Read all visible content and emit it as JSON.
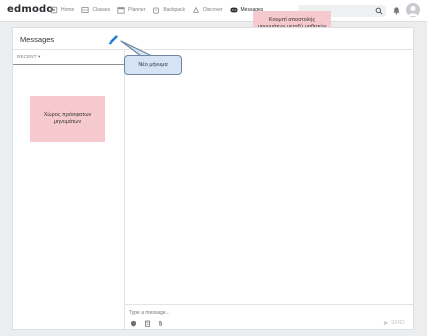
{
  "app": {
    "logo": "edmodo"
  },
  "nav": [
    {
      "label": "Home",
      "icon": "home-icon"
    },
    {
      "label": "Classes",
      "icon": "classes-icon"
    },
    {
      "label": "Planner",
      "icon": "planner-icon"
    },
    {
      "label": "Backpack",
      "icon": "backpack-icon"
    },
    {
      "label": "Discover",
      "icon": "discover-icon"
    },
    {
      "label": "Messages",
      "icon": "messages-icon",
      "active": true
    }
  ],
  "search": {
    "placeholder": "Search"
  },
  "messages": {
    "title": "Messages",
    "filter_label": "RECENT ▾",
    "composer": {
      "placeholder": "Type a message...",
      "send_label": "SEND"
    }
  },
  "annotations": {
    "compose_button_note": "Κουμπί αποστολής μηνυμάτων μεταξύ μαθητών",
    "recent_area_note": "Χώρος πρόσφατων μηνυμάτων",
    "new_message_callout": "Νέο μήνυμα"
  },
  "colors": {
    "accent_blue": "#1f7fd6",
    "annotation_pink": "#f6c9cf",
    "callout_blue": "#d5e4f4",
    "callout_border": "#6f87a3"
  }
}
